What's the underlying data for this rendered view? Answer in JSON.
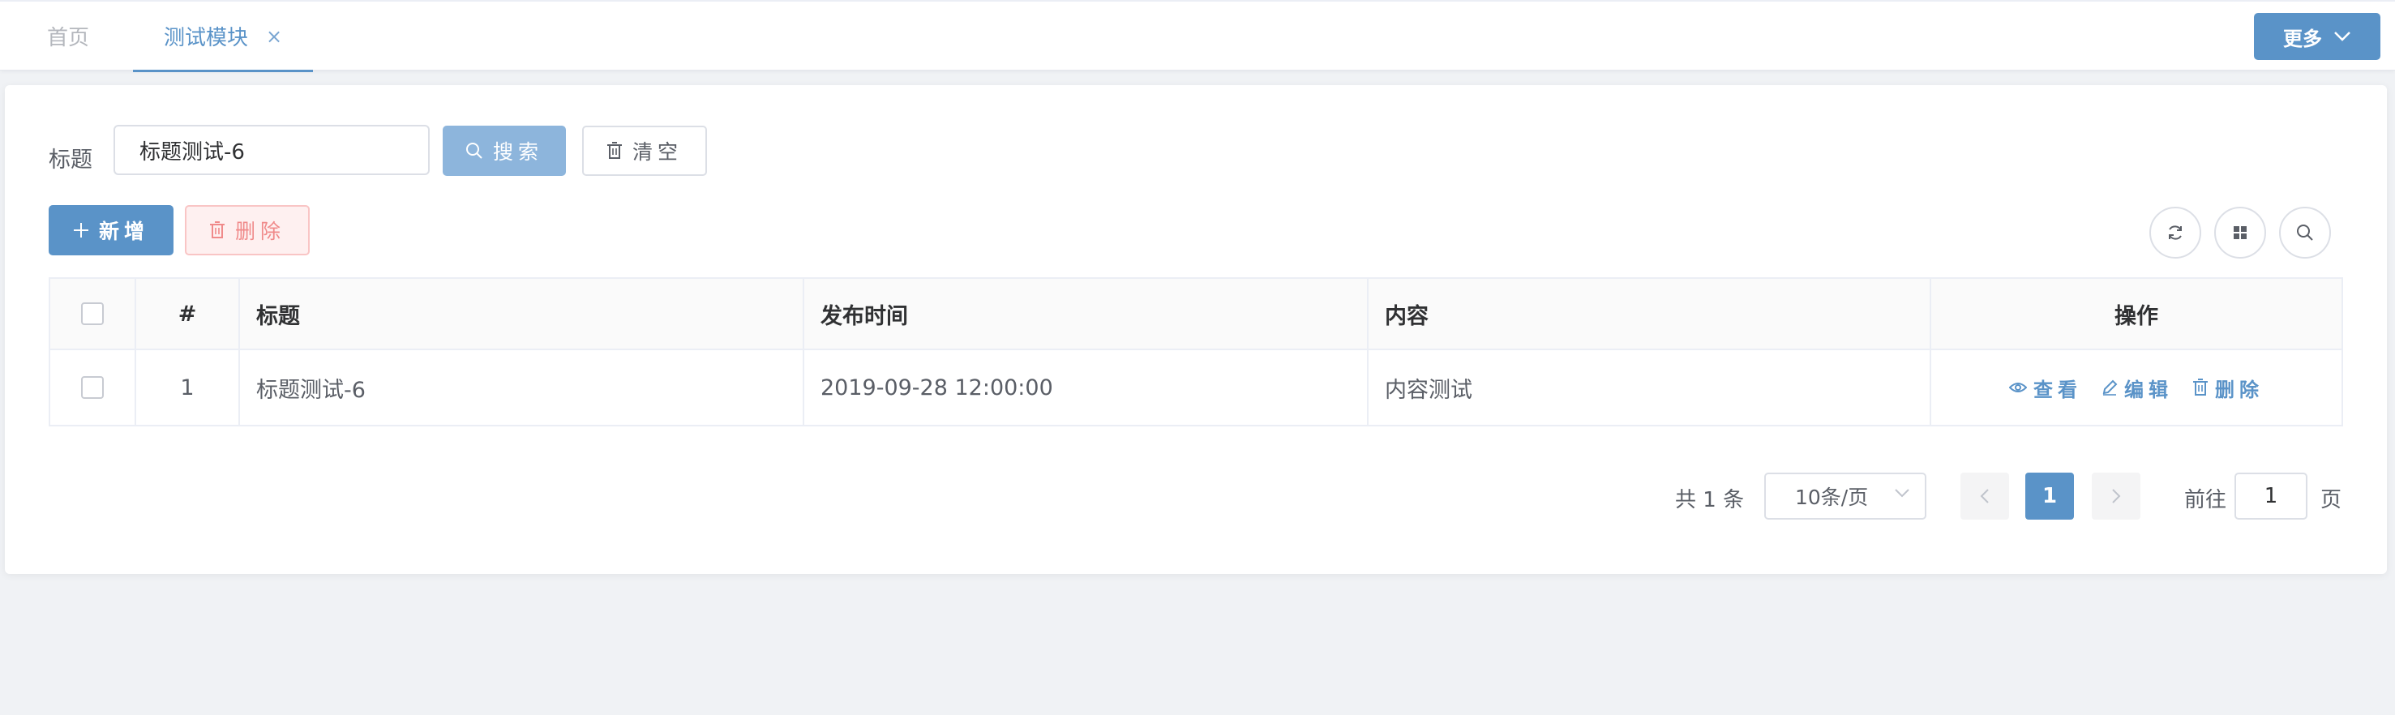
{
  "tabs": {
    "home": "首页",
    "active": "测试模块",
    "close": "×",
    "more": "更多"
  },
  "search": {
    "label": "标题",
    "value": "标题测试-6",
    "search_button": "搜索",
    "clear_button": "清空"
  },
  "toolbar": {
    "add_button": "新增",
    "delete_button": "删除"
  },
  "table": {
    "columns": [
      "#",
      "标题",
      "发布时间",
      "内容",
      "操作"
    ],
    "rows": [
      {
        "index": "1",
        "title": "标题测试-6",
        "time": "2019-09-28 12:00:00",
        "content": "内容测试",
        "actions": [
          "查看",
          "编辑",
          "删除"
        ]
      }
    ]
  },
  "pagination": {
    "total": "共 1 条",
    "page_size": "10条/页",
    "current_page": "1",
    "goto_label": "前往",
    "goto_value": "1",
    "goto_suffix": "页"
  },
  "colors": {
    "primary": "#5a93c8",
    "danger": "#f08a8a",
    "background": "#f0f2f5"
  }
}
